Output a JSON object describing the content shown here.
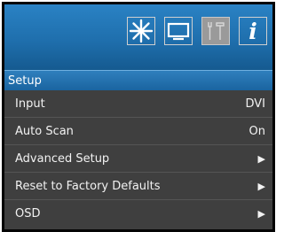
{
  "header": {
    "icons": [
      {
        "name": "picture-settings-icon",
        "selected": false
      },
      {
        "name": "monitor-icon",
        "selected": false
      },
      {
        "name": "tools-icon",
        "selected": true
      },
      {
        "name": "info-icon",
        "selected": false,
        "glyph": "i"
      }
    ]
  },
  "section": {
    "title": "Setup"
  },
  "menu": {
    "items": [
      {
        "label": "Input",
        "value": "DVI"
      },
      {
        "label": "Auto Scan",
        "value": "On"
      },
      {
        "label": "Advanced Setup",
        "value": "▶"
      },
      {
        "label": "Reset to Factory Defaults",
        "value": "▶"
      },
      {
        "label": "OSD",
        "value": "▶"
      }
    ]
  },
  "colors": {
    "header_blue": "#1f6fad",
    "menu_bg": "#3f3f3f",
    "selected_icon_bg": "#9a9a9a",
    "text": "#f2f2f2"
  }
}
